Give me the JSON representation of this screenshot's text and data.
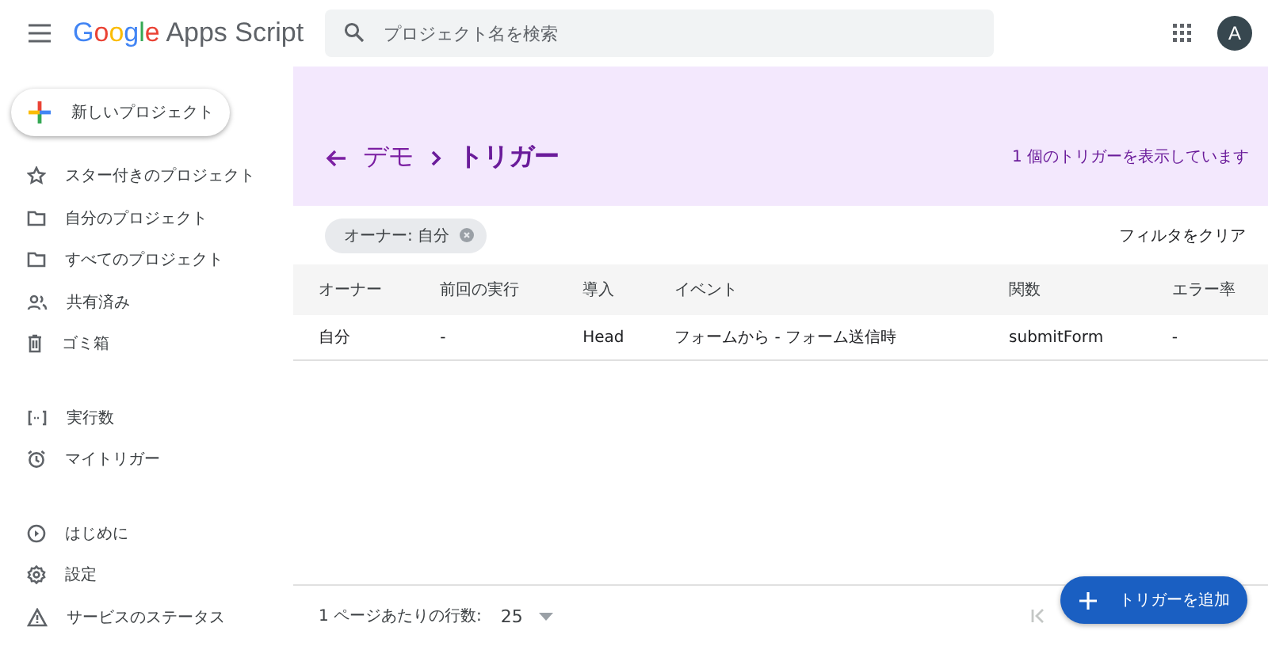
{
  "header": {
    "logo_brand": "Google",
    "logo_product": "Apps Script",
    "search": {
      "placeholder": "プロジェクト名を検索"
    },
    "avatar": "A"
  },
  "sidebar": {
    "new_button": "新しいプロジェクト",
    "groups": [
      [
        "スター付きのプロジェクト",
        "自分のプロジェクト",
        "すべてのプロジェクト",
        "共有済み",
        "ゴミ箱"
      ],
      [
        "実行数",
        "マイトリガー"
      ],
      [
        "はじめに",
        "設定",
        "サービスのステータス"
      ]
    ]
  },
  "banner": {
    "breadcrumb": [
      "デモ",
      "トリガー"
    ],
    "count_text": "1 個のトリガーを表示しています"
  },
  "filter": {
    "chip": "オーナー: 自分",
    "clear": "フィルタをクリア"
  },
  "table": {
    "columns": [
      "オーナー",
      "前回の実行",
      "導入",
      "イベント",
      "関数",
      "エラー率"
    ],
    "rows": [
      [
        "自分",
        "-",
        "Head",
        "フォームから - フォーム送信時",
        "submitForm",
        "-"
      ]
    ]
  },
  "footer": {
    "rows_label": "1 ページあたりの行数:",
    "rows_value": "25",
    "add_button": "トリガーを追加"
  }
}
